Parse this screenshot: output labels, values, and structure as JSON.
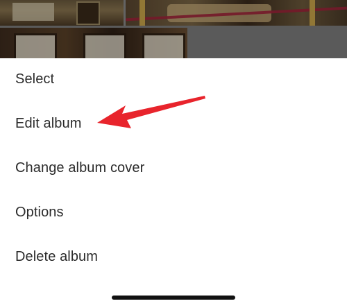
{
  "menu": {
    "items": [
      {
        "label": "Select"
      },
      {
        "label": "Edit album"
      },
      {
        "label": "Change album cover"
      },
      {
        "label": "Options"
      },
      {
        "label": "Delete album"
      }
    ]
  },
  "colors": {
    "menu_text": "#2b2b2b",
    "sheet_background": "#ffffff",
    "annotation_arrow": "#e8242c",
    "home_indicator": "#111111"
  },
  "icons": {
    "annotation": "red-pointer-arrow-icon"
  }
}
